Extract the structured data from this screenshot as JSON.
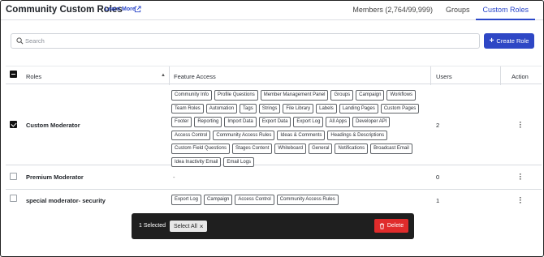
{
  "header": {
    "title": "Community Custom Roles",
    "learn_more": "Learn More",
    "tabs": [
      {
        "label": "Members (2,764/99,999)",
        "active": false
      },
      {
        "label": "Groups",
        "active": false
      },
      {
        "label": "Custom Roles",
        "active": true
      }
    ]
  },
  "search": {
    "placeholder": "Search",
    "value": ""
  },
  "toolbar": {
    "create_label": "Create Role"
  },
  "table": {
    "columns": {
      "roles": "Roles",
      "feature_access": "Feature Access",
      "users": "Users",
      "action": "Action"
    },
    "rows": [
      {
        "checked": true,
        "name": "Custom Moderator",
        "users": "2",
        "features": [
          "Community Info",
          "Profile Questions",
          "Member Management Panel",
          "Groups",
          "Campaign",
          "Workflows",
          "Team Roles",
          "Automation",
          "Tags",
          "Strings",
          "File Library",
          "Labels",
          "Landing Pages",
          "Custom Pages",
          "Footer",
          "Reporting",
          "Import Data",
          "Export Data",
          "Export Log",
          "All Apps",
          "Developer API",
          "Access Control",
          "Community Access Rules",
          "Ideas & Comments",
          "Headings & Descriptions",
          "Custom Field Questions",
          "Stages Content",
          "Whiteboard",
          "General",
          "Notifications",
          "Broadcast Email",
          "Idea Inactivity Email",
          "Email Logs"
        ]
      },
      {
        "checked": false,
        "name": "Premium Moderator",
        "users": "0",
        "features_empty": "-"
      },
      {
        "checked": false,
        "name": "special moderator- security",
        "users": "1",
        "features": [
          "Export Log",
          "Campaign",
          "Access Control",
          "Community Access Rules"
        ]
      }
    ]
  },
  "selection_bar": {
    "count_text": "1 Selected",
    "select_all_label": "Select All",
    "delete_label": "Delete"
  },
  "colors": {
    "accent": "#2e47c5",
    "danger": "#e02b2b",
    "bar_bg": "#1f1f1f"
  }
}
